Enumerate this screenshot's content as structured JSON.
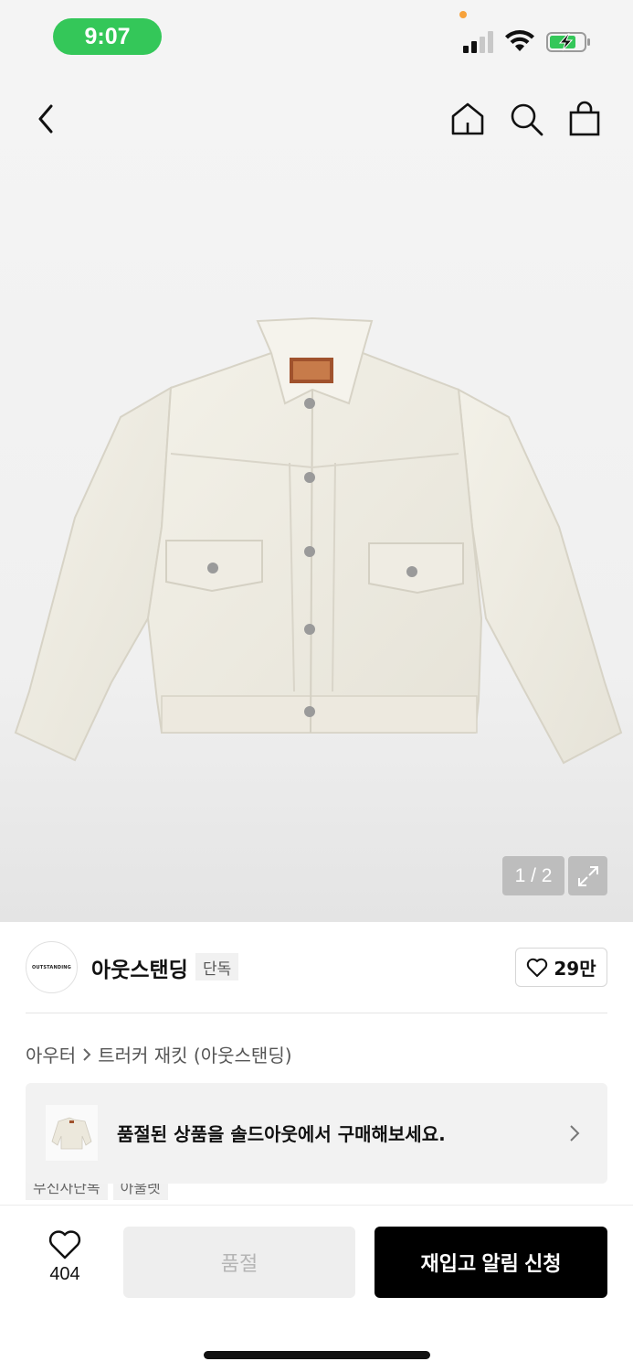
{
  "status_bar": {
    "time": "9:07"
  },
  "header": {
    "back_icon": "chevron-left-icon",
    "home_icon": "home-icon",
    "search_icon": "search-icon",
    "bag_icon": "shopping-bag-icon"
  },
  "gallery": {
    "counter": "1 / 2",
    "expand_icon": "expand-icon"
  },
  "brand": {
    "logo_text": "OUTSTANDING",
    "name": "아웃스탠딩",
    "exclusive_label": "단독",
    "likes": "29만"
  },
  "breadcrumb": {
    "category": "아우터",
    "product": "트러커 재킷 (아웃스탠딩)"
  },
  "soldout_banner": {
    "message": "품절된 상품을 솔드아웃에서 구매해보세요."
  },
  "tags": [
    "무신사단독",
    "아울렛"
  ],
  "bottom_bar": {
    "wish_count": "404",
    "soldout_label": "품절",
    "restock_label": "재입고 알림 신청"
  },
  "colors": {
    "accent_green": "#34c759",
    "primary_black": "#000000",
    "disabled_gray": "#eeeeee"
  }
}
